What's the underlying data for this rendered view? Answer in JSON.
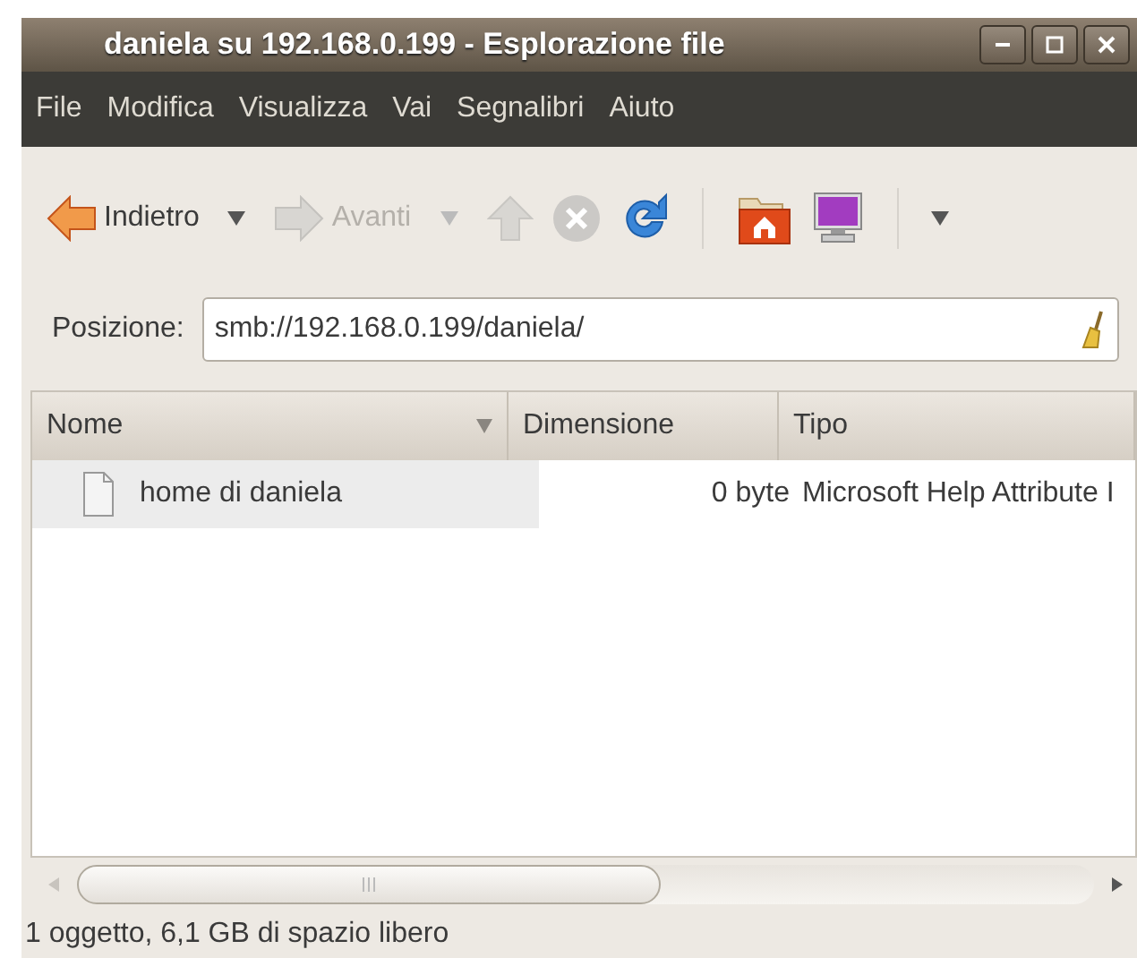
{
  "window": {
    "title": "daniela su 192.168.0.199 - Esplorazione file"
  },
  "menu": [
    "File",
    "Modifica",
    "Visualizza",
    "Vai",
    "Segnalibri",
    "Aiuto"
  ],
  "toolbar": [
    {
      "kind": "back",
      "label": "Indietro",
      "disabled": false,
      "dropdown": true
    },
    {
      "kind": "forward",
      "label": "Avanti",
      "disabled": true,
      "dropdown": true
    },
    {
      "kind": "up",
      "disabled": true
    },
    {
      "kind": "stop",
      "disabled": true
    },
    {
      "kind": "reload",
      "disabled": false
    },
    {
      "kind": "separator"
    },
    {
      "kind": "home",
      "disabled": false
    },
    {
      "kind": "computer",
      "disabled": false
    },
    {
      "kind": "separator"
    },
    {
      "kind": "overflow",
      "disabled": false
    }
  ],
  "location": {
    "label": "Posizione:",
    "value": "smb://192.168.0.199/daniela/"
  },
  "table": {
    "columns": [
      {
        "label": "Nome",
        "sorted": true
      },
      {
        "label": "Dimensione",
        "sorted": false
      },
      {
        "label": "Tipo",
        "sorted": false
      }
    ],
    "rows": [
      {
        "cells": [
          "home di daniela",
          "0 byte",
          "Microsoft Help Attribute I"
        ]
      }
    ]
  },
  "status_bar": "1 oggetto, 6,1 GB di spazio libero"
}
